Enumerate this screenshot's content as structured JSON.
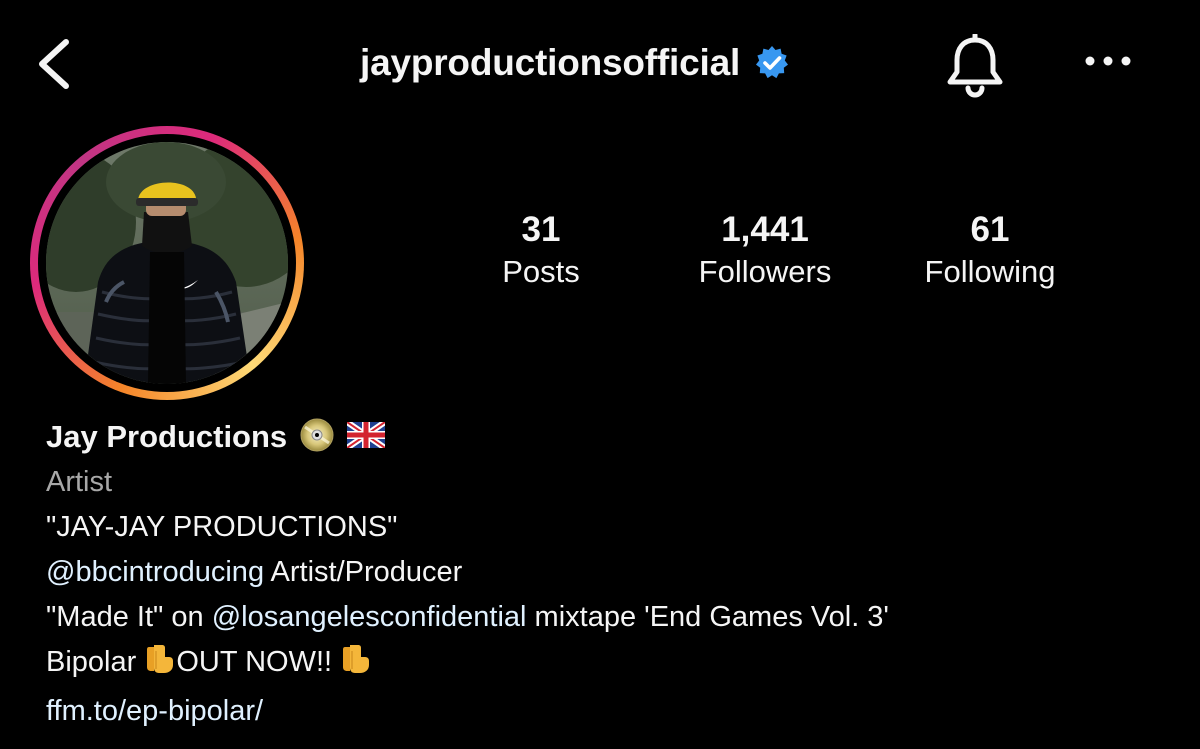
{
  "header": {
    "username": "jayproductionsofficial",
    "verified": true,
    "icons": [
      "back-arrow-icon",
      "verified-badge-icon",
      "bell-icon",
      "more-horizontal-icon"
    ],
    "accent_color": "#3897f0"
  },
  "avatar": {
    "ring_colors": [
      "#feda77",
      "#f58529",
      "#dd2a7b",
      "#c13584"
    ]
  },
  "stats": {
    "posts_count": "31",
    "posts_label": "Posts",
    "followers_count": "1,441",
    "followers_label": "Followers",
    "following_count": "61",
    "following_label": "Following"
  },
  "bio": {
    "display_name": "Jay Productions",
    "name_emojis": [
      "cd-disc-icon",
      "uk-flag-icon"
    ],
    "category": "Artist",
    "line1": "\"JAY-JAY PRODUCTIONS\"",
    "line2_mention": "@bbcintroducing",
    "line2_text": " Artist/Producer",
    "line3_prefix": "\"Made It\" on ",
    "line3_mention": "@losangelesconfidential",
    "line3_suffix": " mixtape 'End Games Vol. 3'",
    "line4_part1": "Bipolar ",
    "line4_part2": "OUT NOW!! ",
    "line4_emoji": "pointing-down-icon",
    "link": "ffm.to/ep-bipolar/",
    "link_color": "#e0f1ff"
  }
}
